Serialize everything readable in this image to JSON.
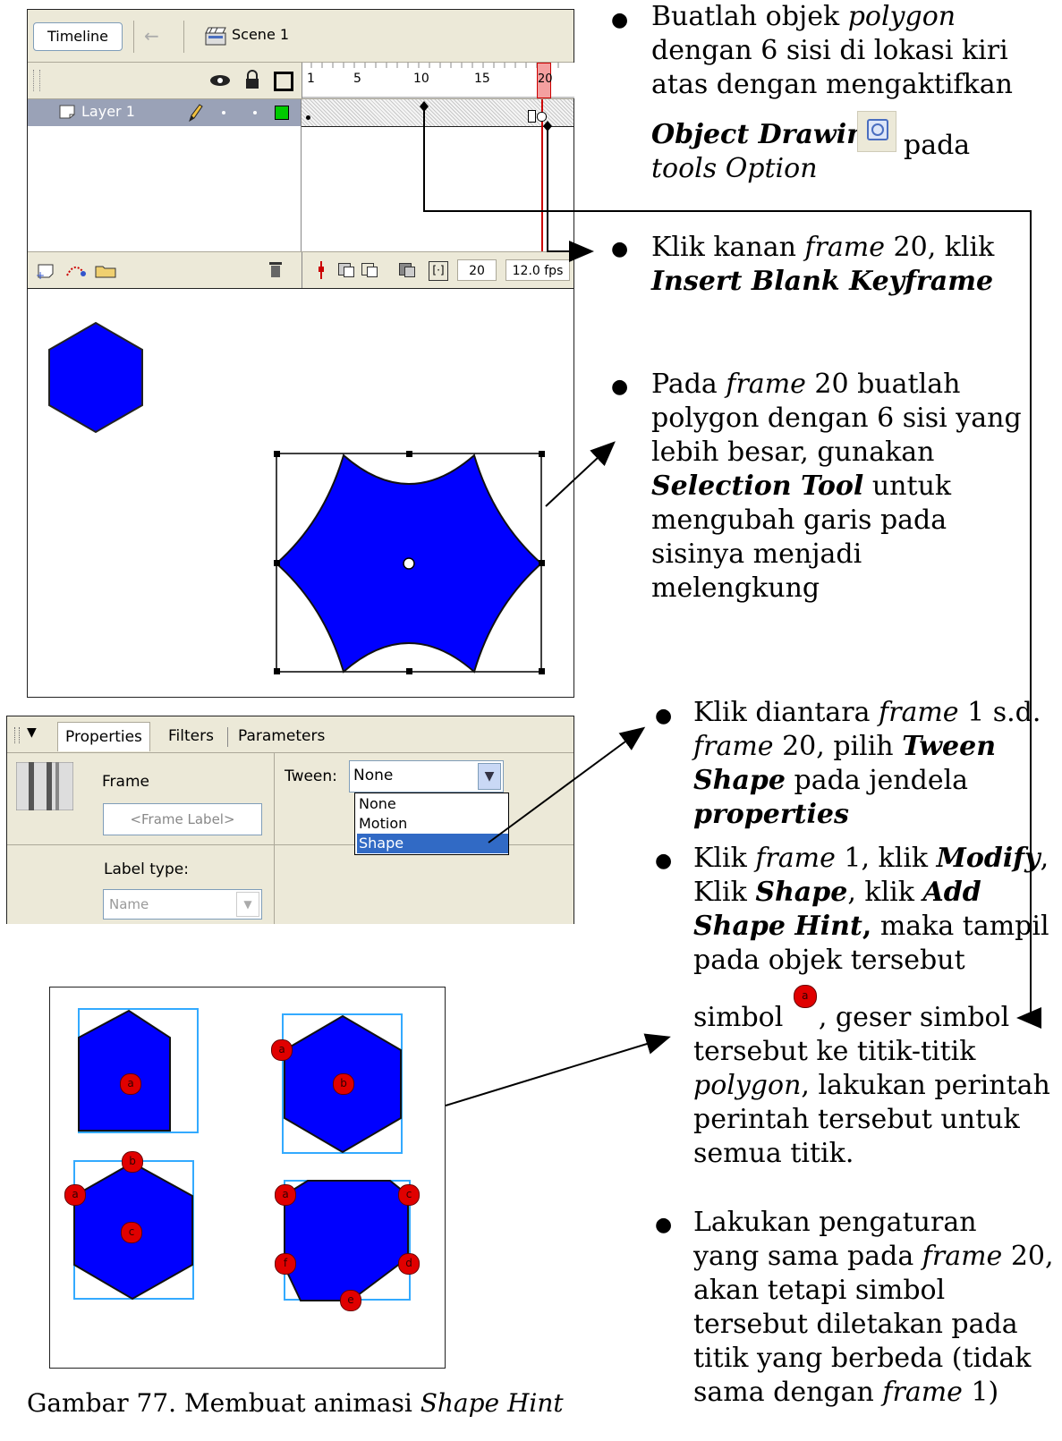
{
  "timeline": {
    "timeline_button": "Timeline",
    "scene_label": "Scene 1",
    "ruler": [
      "1",
      "5",
      "10",
      "15",
      "20"
    ],
    "layer_name": "Layer 1",
    "frame_number": "20",
    "fps": "12.0 fps"
  },
  "properties": {
    "tabs": [
      "Properties",
      "Filters",
      "Parameters"
    ],
    "frame_label": "Frame",
    "frame_label_placeholder": "<Frame Label>",
    "tween_label": "Tween:",
    "tween_value": "None",
    "tween_options": [
      "None",
      "Motion",
      "Shape"
    ],
    "label_type_label": "Label type:",
    "label_type_value": "Name"
  },
  "hints": {
    "markers": [
      "a",
      "b",
      "c",
      "d",
      "e",
      "f"
    ]
  },
  "caption": {
    "prefix": "Gambar 77. Membuat animasi ",
    "italic": "Shape Hint"
  },
  "instructions": [
    {
      "lines": [
        [
          "Buatlah objek ",
          {
            "i": "polygon"
          }
        ],
        [
          "dengan 6 sisi di lokasi kiri"
        ],
        [
          "atas dengan mengaktifkan"
        ],
        [
          {
            "bi": "Object Drawing"
          }
        ],
        [
          {
            "i": "tools Option"
          }
        ]
      ],
      "trailing": "pada"
    },
    {
      "lines": [
        [
          "Klik kanan ",
          {
            "i": "frame"
          },
          " 20, klik"
        ],
        [
          {
            "bi": "Insert Blank Keyframe"
          }
        ]
      ]
    },
    {
      "lines": [
        [
          "Pada ",
          {
            "i": "frame"
          },
          " 20 buatlah"
        ],
        [
          "polygon dengan 6 sisi yang"
        ],
        [
          "lebih besar, gunakan"
        ],
        [
          {
            "bi": "Selection Tool"
          },
          " untuk"
        ],
        [
          "mengubah garis pada"
        ],
        [
          "sisinya menjadi"
        ],
        [
          "melengkung"
        ]
      ]
    },
    {
      "lines": [
        [
          "Klik diantara ",
          {
            "i": "frame"
          },
          " 1 s.d."
        ],
        [
          {
            "i": "frame"
          },
          " 20, pilih ",
          {
            "bi": "Tween"
          }
        ],
        [
          {
            "bi": "Shape"
          },
          " pada jendela"
        ],
        [
          {
            "bi": "properties"
          }
        ]
      ]
    },
    {
      "lines": [
        [
          "Klik ",
          {
            "i": "frame"
          },
          " 1, klik ",
          {
            "bi": "Modify"
          },
          ","
        ],
        [
          "Klik ",
          {
            "bi": "Shape"
          },
          ", klik ",
          {
            "bi": "Add"
          }
        ],
        [
          {
            "bi": "Shape Hint"
          },
          {
            "b": ","
          },
          " maka tampil"
        ],
        [
          "pada objek tersebut"
        ],
        [
          "simbol "
        ],
        [
          "tersebut ke titik-titik"
        ],
        [
          {
            "i": "polygon"
          },
          ", lakukan perintah"
        ],
        [
          "perintah tersebut untuk"
        ],
        [
          "semua titik."
        ]
      ],
      "symbol_suffix": ", geser simbol"
    },
    {
      "lines": [
        [
          "Lakukan pengaturan"
        ],
        [
          "yang sama pada ",
          {
            "i": "frame"
          },
          " 20,"
        ],
        [
          "akan tetapi simbol"
        ],
        [
          "tersebut diletakan pada"
        ],
        [
          "titik yang berbeda (tidak"
        ],
        [
          "sama dengan ",
          {
            "i": "frame"
          },
          " 1)"
        ]
      ]
    }
  ],
  "colors": {
    "shape_fill": "#0000ff",
    "hint_red": "#e00000",
    "bbox_cyan": "#33aaff",
    "playhead": "#cc0000"
  }
}
